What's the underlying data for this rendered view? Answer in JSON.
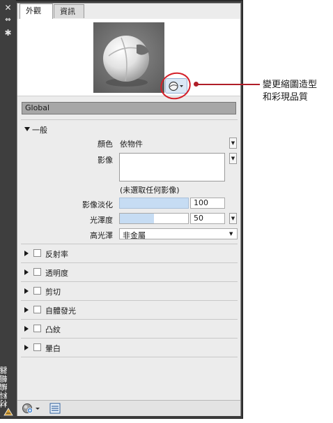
{
  "palette": {
    "title": "材料編輯器",
    "close_glyph": "✕",
    "autohide_glyph": "⇔",
    "properties_glyph": "✱"
  },
  "tabs": [
    {
      "label": "外觀",
      "active": true
    },
    {
      "label": "資訊",
      "active": false
    }
  ],
  "preview": {
    "swatch_icon": "sphere-swatch-icon"
  },
  "material_name": "Global",
  "general": {
    "heading": "一般",
    "color_label": "顏色",
    "color_value": "依物件",
    "image_label": "影像",
    "image_none": "(未選取任何影像)",
    "image_fade_label": "影像淡化",
    "image_fade_value": "100",
    "image_fade_fraction": 1.0,
    "glossiness_label": "光澤度",
    "glossiness_value": "50",
    "glossiness_fraction": 0.5,
    "highlights_label": "高光澤",
    "highlights_value": "非金屬"
  },
  "sections": [
    {
      "label": "反射率"
    },
    {
      "label": "透明度"
    },
    {
      "label": "剪切"
    },
    {
      "label": "自體發光"
    },
    {
      "label": "凸紋"
    },
    {
      "label": "暈白"
    }
  ],
  "callout": {
    "line1": "變更縮圖造型",
    "line2": "和彩現品質"
  },
  "colors": {
    "callout_red": "#b01e28",
    "slider_fill": "#c6dcf3"
  }
}
